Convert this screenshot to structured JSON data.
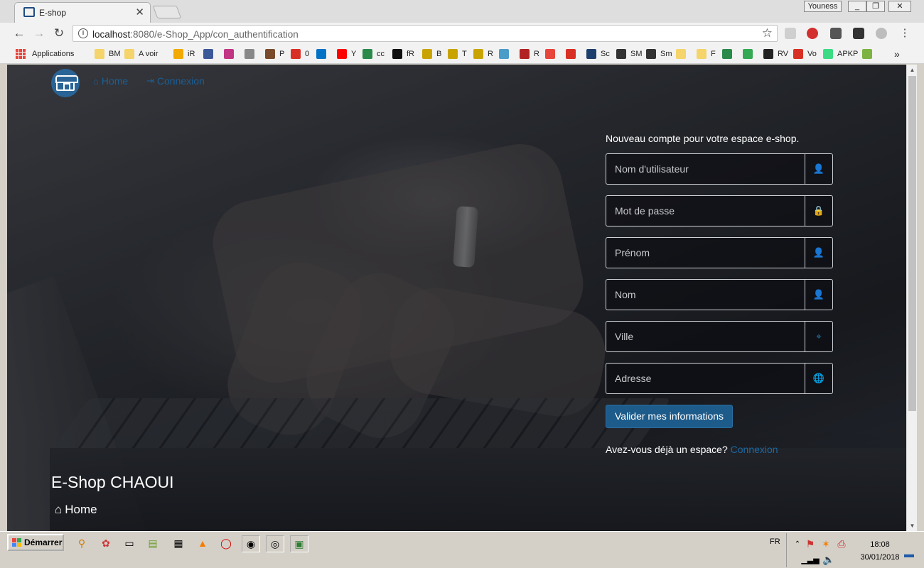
{
  "browser": {
    "tab_title": "E-shop",
    "tab_close": "✕",
    "profile_name": "Youness",
    "window_buttons": [
      "_",
      "❐",
      "✕"
    ],
    "url_host": "localhost",
    "url_rest": ":8080/e-Shop_App/con_authentification",
    "nav_icons": [
      "back-icon",
      "forward-icon",
      "reload-icon"
    ]
  },
  "bookmarks": [
    {
      "label": "Applications",
      "color": "#e8453c"
    },
    {
      "label": "BM",
      "color": "#f4d46b"
    },
    {
      "label": "A voir",
      "color": "#f4d46b"
    },
    {
      "label": "iR",
      "color": "#f2a900"
    },
    {
      "label": "",
      "color": "#3b5998"
    },
    {
      "label": "",
      "color": "#c13584"
    },
    {
      "label": "",
      "color": "#888888"
    },
    {
      "label": "P",
      "color": "#7a4b2a"
    },
    {
      "label": "0",
      "color": "#d93025"
    },
    {
      "label": "",
      "color": "#0072c6"
    },
    {
      "label": "Y",
      "color": "#ff0000"
    },
    {
      "label": "cc",
      "color": "#2a8a4a"
    },
    {
      "label": "fR",
      "color": "#111111"
    },
    {
      "label": "B",
      "color": "#c9a400"
    },
    {
      "label": "T",
      "color": "#c9a400"
    },
    {
      "label": "R",
      "color": "#c9a400"
    },
    {
      "label": "",
      "color": "#4a9cc9"
    },
    {
      "label": "R",
      "color": "#b22222"
    },
    {
      "label": "",
      "color": "#e8453c"
    },
    {
      "label": "",
      "color": "#d93025"
    },
    {
      "label": "Sc",
      "color": "#1c3f6e"
    },
    {
      "label": "SM",
      "color": "#333333"
    },
    {
      "label": "Sm",
      "color": "#333333"
    },
    {
      "label": "",
      "color": "#f4d46b"
    },
    {
      "label": "F",
      "color": "#f4d46b"
    },
    {
      "label": "",
      "color": "#2a8a4a"
    },
    {
      "label": "",
      "color": "#34a853"
    },
    {
      "label": "RV",
      "color": "#222222"
    },
    {
      "label": "Vo",
      "color": "#d93025"
    },
    {
      "label": "APKP",
      "color": "#3ddc84"
    },
    {
      "label": "",
      "color": "#7cb342"
    }
  ],
  "bookmarks_more": "»",
  "site": {
    "nav": [
      {
        "label": "Home",
        "icon": "home-icon"
      },
      {
        "label": "Connexion",
        "icon": "login-icon"
      }
    ],
    "form": {
      "title": "Nouveau compte pour votre espace e-shop.",
      "fields": [
        {
          "placeholder": "Nom d'utilisateur",
          "icon": "user-icon",
          "glyph": "👤"
        },
        {
          "placeholder": "Mot de passe",
          "icon": "lock-icon",
          "glyph": "🔒"
        },
        {
          "placeholder": "Prénom",
          "icon": "user-icon",
          "glyph": "👤"
        },
        {
          "placeholder": "Nom",
          "icon": "user-icon",
          "glyph": "👤"
        },
        {
          "placeholder": "Ville",
          "icon": "crosshair-icon",
          "glyph": "⌖"
        },
        {
          "placeholder": "Adresse",
          "icon": "globe-icon",
          "glyph": "🌐"
        }
      ],
      "submit_label": "Valider mes informations",
      "already_text": "Avez-vous déjà un espace?",
      "login_link": "Connexion"
    },
    "footer": {
      "brand": "E-Shop CHAOUI",
      "home_label": "Home"
    }
  },
  "taskbar": {
    "start_label": "Démarrer",
    "language": "FR",
    "time": "18:08",
    "date": "30/01/2018"
  }
}
